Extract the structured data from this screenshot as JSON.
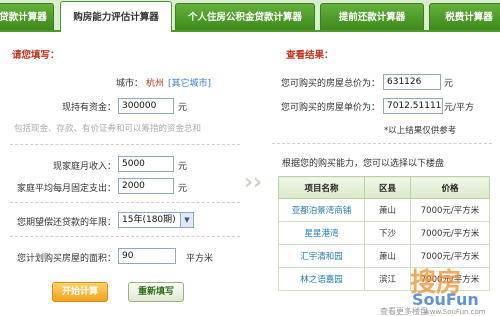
{
  "tabs": [
    {
      "label": "贷款计算器",
      "active": false
    },
    {
      "label": "购房能力评估计算器",
      "active": true
    },
    {
      "label": "个人住房公积金贷款计算器",
      "active": false
    },
    {
      "label": "提前还款计算器",
      "active": false
    },
    {
      "label": "税费计算器",
      "active": false
    }
  ],
  "form": {
    "heading": "请您填写：",
    "city_label": "城市：",
    "city_value": "杭州",
    "city_other": "[其它城市]",
    "funds_label": "现持有资金：",
    "funds_value": "300000",
    "funds_unit": "元",
    "funds_hint": "包括现金、存款、有价证券和可以筹措的资金总和",
    "income_label": "现家庭月收入：",
    "income_value": "5000",
    "income_unit": "元",
    "expense_label": "家庭平均每月固定支出：",
    "expense_value": "2000",
    "expense_unit": "元",
    "years_label": "您期望偿还贷款的年限：",
    "years_value": "15年(180期)",
    "area_label": "您计划购买房屋的面积：",
    "area_value": "90",
    "area_unit": "平方米",
    "start_button": "开始计算",
    "reset_button": "重新填写"
  },
  "results": {
    "heading": "查看结果：",
    "total_label": "您可购买的房屋总价为：",
    "total_value": "631126",
    "total_unit": "元",
    "unit_label": "您可购买的房屋单价为：",
    "unit_value": "7012.511111",
    "unit_unit": "元/平方",
    "note": "*以上结果仅供参考",
    "recommend_caption": "根据您的购买能力，您可以选择以下楼盘",
    "table_headers": [
      "项目名称",
      "区县",
      "价格"
    ],
    "table_rows": [
      {
        "name": "亚都泊景湾商铺",
        "district": "萧山",
        "price": "7000元/平方米"
      },
      {
        "name": "星星港湾",
        "district": "下沙",
        "price": "7000元/平方米"
      },
      {
        "name": "汇宇清和园",
        "district": "萧山",
        "price": "7000元/平方米"
      },
      {
        "name": "林之语嘉园",
        "district": "滨江",
        "price": "7000元/平方米"
      }
    ]
  },
  "watermark": {
    "chinese": "搜房",
    "english": "SouFun",
    "url": "www.SouFun.com"
  },
  "footer_note": "查看更多楼盘"
}
